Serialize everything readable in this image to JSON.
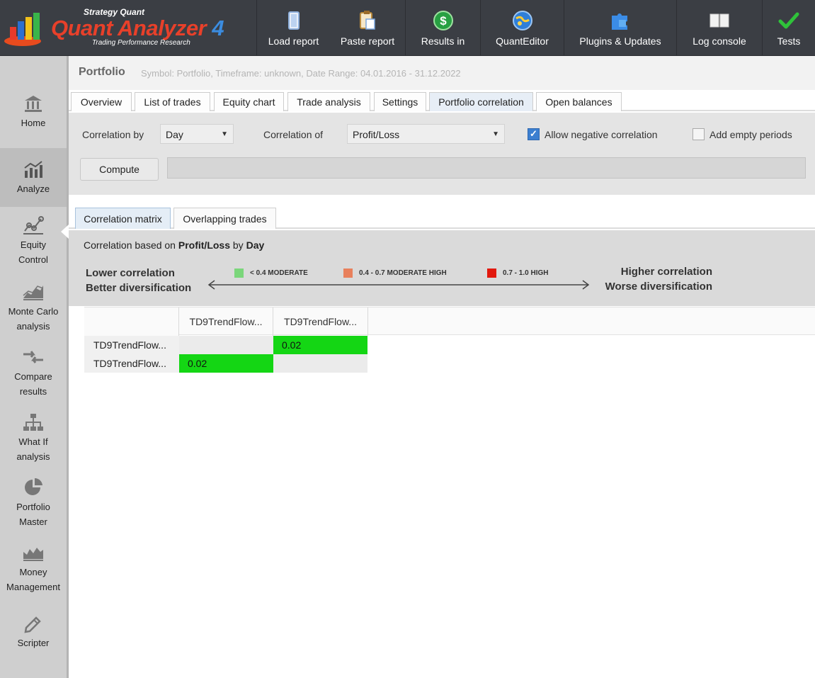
{
  "logo": {
    "top": "Strategy Quant",
    "main": "Quant Analyzer",
    "version": "4",
    "sub": "Trading Performance      Research"
  },
  "toolbar": [
    {
      "label": "Load report",
      "icon": "file-icon"
    },
    {
      "label": "Paste report",
      "icon": "clipboard-icon"
    },
    {
      "label": "Results in",
      "icon": "dollar-icon"
    },
    {
      "label": "QuantEditor",
      "icon": "globe-icon"
    },
    {
      "label": "Plugins & Updates",
      "icon": "puzzle-icon"
    },
    {
      "label": "Log console",
      "icon": "book-icon"
    },
    {
      "label": "Tests",
      "icon": "check-icon"
    }
  ],
  "sidebar": {
    "items": [
      {
        "label": "Home",
        "icon": "bank-icon"
      },
      {
        "label": "Analyze",
        "icon": "chart-icon"
      },
      {
        "label": "Equity\nControl",
        "icon": "equity-icon"
      },
      {
        "label": "Monte Carlo\nanalysis",
        "icon": "montecarlo-icon"
      },
      {
        "label": "Compare\nresults",
        "icon": "compare-icon"
      },
      {
        "label": "What If\nanalysis",
        "icon": "hierarchy-icon"
      },
      {
        "label": "Portfolio\nMaster",
        "icon": "pie-icon"
      },
      {
        "label": "Money\nManagement",
        "icon": "money-chart-icon"
      },
      {
        "label": "Scripter",
        "icon": "pencil-icon"
      }
    ]
  },
  "header": {
    "title": "Portfolio",
    "meta": "Symbol: Portfolio, Timeframe: unknown, Date Range: 04.01.2016 - 31.12.2022"
  },
  "tabs": [
    "Overview",
    "List of trades",
    "Equity chart",
    "Trade analysis",
    "Settings",
    "Portfolio correlation",
    "Open balances"
  ],
  "settings": {
    "correlation_by_label": "Correlation by",
    "correlation_by_value": "Day",
    "correlation_of_label": "Correlation of",
    "correlation_of_value": "Profit/Loss",
    "allow_negative_label": "Allow negative correlation",
    "allow_negative_checked": true,
    "add_empty_label": "Add empty periods",
    "add_empty_checked": false,
    "compute_label": "Compute"
  },
  "subtabs": [
    "Correlation matrix",
    "Overlapping trades"
  ],
  "legend": {
    "based_prefix": "Correlation based on ",
    "based_metric": "Profit/Loss",
    "based_mid": " by ",
    "based_period": "Day",
    "lower_line1": "Lower correlation",
    "lower_line2": "Better diversification",
    "higher_line1": "Higher correlation",
    "higher_line2": "Worse diversification",
    "items": [
      {
        "label": "< 0.4 MODERATE",
        "color": "#7bd67b"
      },
      {
        "label": "0.4 - 0.7 MODERATE HIGH",
        "color": "#e8805c"
      },
      {
        "label": "0.7 - 1.0 HIGH",
        "color": "#e2190e"
      }
    ]
  },
  "matrix": {
    "columns": [
      "TD9TrendFlow...",
      "TD9TrendFlow..."
    ],
    "rows": [
      {
        "label": "TD9TrendFlow...",
        "values": [
          "",
          "0.02"
        ]
      },
      {
        "label": "TD9TrendFlow...",
        "values": [
          "0.02",
          ""
        ]
      }
    ],
    "green_color": "#14d614"
  }
}
